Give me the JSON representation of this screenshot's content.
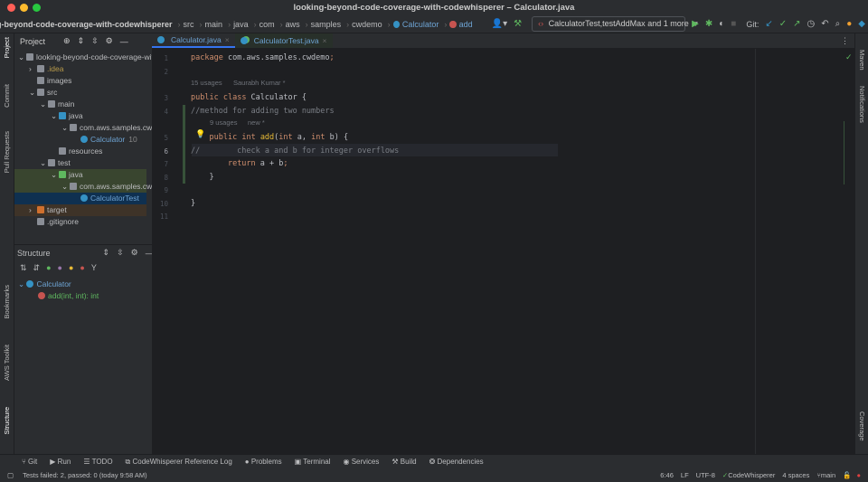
{
  "window": {
    "title": "looking-beyond-code-coverage-with-codewhisperer – Calculator.java"
  },
  "breadcrumb": [
    "g-beyond-code-coverage-with-codewhisperer",
    "src",
    "main",
    "java",
    "com",
    "aws",
    "samples",
    "cwdemo",
    "Calculator",
    "add"
  ],
  "toolbar": {
    "run_config": "CalculatorTest,testAddMax and 1 more",
    "git_label": "Git:"
  },
  "left_strip": [
    "Project",
    "Commit",
    "Pull Requests",
    "Bookmarks",
    "AWS Toolkit",
    "Structure"
  ],
  "right_strip": [
    "Maven",
    "Notifications",
    "Coverage"
  ],
  "project": {
    "title": "Project",
    "tree": [
      {
        "label": "looking-beyond-code-coverage-with-codewhisperer",
        "depth": 0,
        "type": "module"
      },
      {
        "label": ".idea",
        "depth": 1,
        "type": "folder"
      },
      {
        "label": "images",
        "depth": 1,
        "type": "folder"
      },
      {
        "label": "src",
        "depth": 1,
        "type": "folder"
      },
      {
        "label": "main",
        "depth": 2,
        "type": "folder"
      },
      {
        "label": "java",
        "depth": 3,
        "type": "src"
      },
      {
        "label": "com.aws.samples.cwdemo",
        "depth": 4,
        "type": "package"
      },
      {
        "label": "Calculator",
        "depth": 5,
        "type": "class",
        "extra": "10"
      },
      {
        "label": "resources",
        "depth": 3,
        "type": "folder"
      },
      {
        "label": "test",
        "depth": 2,
        "type": "folder"
      },
      {
        "label": "java",
        "depth": 3,
        "type": "test"
      },
      {
        "label": "com.aws.samples.cwdemo",
        "depth": 4,
        "type": "package"
      },
      {
        "label": "CalculatorTest",
        "depth": 5,
        "type": "class"
      },
      {
        "label": "target",
        "depth": 1,
        "type": "target"
      },
      {
        "label": ".gitignore",
        "depth": 1,
        "type": "file"
      }
    ]
  },
  "structure": {
    "title": "Structure",
    "items": [
      {
        "label": "Calculator"
      },
      {
        "label": "add(int, int): int"
      }
    ]
  },
  "tabs": [
    {
      "label": "Calculator.java",
      "active": true
    },
    {
      "label": "CalculatorTest.java",
      "active": false
    }
  ],
  "editor": {
    "hints": {
      "class_usages": "15 usages",
      "class_author": "Saurabh Kumar *",
      "method_usages": "9 usages",
      "method_author": "new *"
    },
    "lines": [
      {
        "n": "1",
        "text": "package com.aws.samples.cwdemo;"
      },
      {
        "n": "2",
        "text": ""
      },
      {
        "n": "3",
        "text": "public class Calculator {"
      },
      {
        "n": "4",
        "text": "//method for adding two numbers"
      },
      {
        "n": "5",
        "text": "    public int add(int a, int b) {"
      },
      {
        "n": "6",
        "text": "//        check a and b for integer overflows"
      },
      {
        "n": "7",
        "text": "        return a + b;"
      },
      {
        "n": "8",
        "text": "    }"
      },
      {
        "n": "9",
        "text": ""
      },
      {
        "n": "10",
        "text": "}"
      },
      {
        "n": "11",
        "text": ""
      }
    ]
  },
  "bottom_tools": [
    "Git",
    "Run",
    "TODO",
    "CodeWhisperer Reference Log",
    "Problems",
    "Terminal",
    "Services",
    "Build",
    "Dependencies"
  ],
  "status": {
    "message": "Tests failed: 2, passed: 0 (today 9:58 AM)",
    "position": "6:46",
    "line_sep": "LF",
    "encoding": "UTF-8",
    "codewhisperer": "CodeWhisperer",
    "indent": "4 spaces",
    "branch": "main"
  }
}
